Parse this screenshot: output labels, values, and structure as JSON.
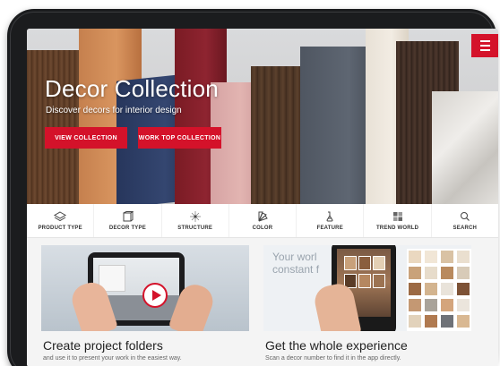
{
  "hero": {
    "title": "Decor Collection",
    "subtitle": "Discover decors for interior design",
    "buttons": {
      "view_collection": "VIEW COLLECTION",
      "worktop_collection": "WORK TOP COLLECTION"
    },
    "accent_color": "#d4122a"
  },
  "menu": {
    "icon": "hamburger-menu-icon"
  },
  "category_nav": {
    "items": [
      {
        "label": "PRODUCT TYPE",
        "icon": "layers-icon"
      },
      {
        "label": "DECOR TYPE",
        "icon": "panel-icon"
      },
      {
        "label": "STRUCTURE",
        "icon": "sparkle-icon"
      },
      {
        "label": "COLOR",
        "icon": "color-fan-icon"
      },
      {
        "label": "FEATURE",
        "icon": "feature-icon"
      },
      {
        "label": "TREND WORLD",
        "icon": "grid-icon"
      },
      {
        "label": "SEARCH",
        "icon": "search-icon"
      }
    ]
  },
  "cards": {
    "left": {
      "title": "Create project folders",
      "description": "and use it to present your work in the easiest way."
    },
    "right": {
      "title": "Get the whole experience",
      "description": "Scan a decor number to find it in the app directly.",
      "image_text_line1": "Your worl",
      "image_text_line2": "constant f"
    }
  }
}
